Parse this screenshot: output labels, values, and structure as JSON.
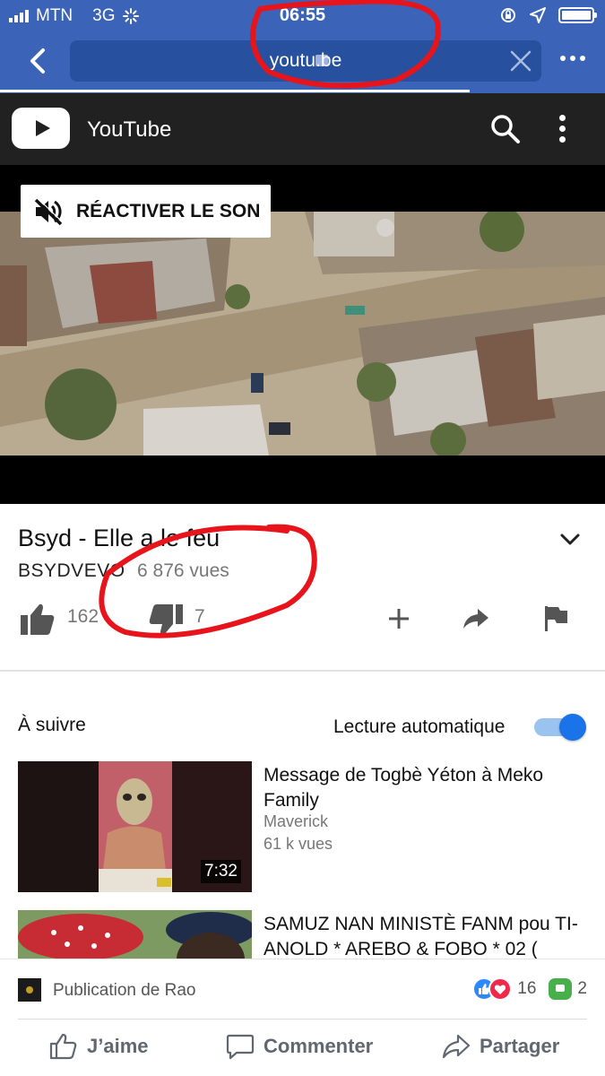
{
  "status_bar": {
    "carrier": "MTN",
    "network": "3G",
    "time": "06:55"
  },
  "browser": {
    "url": "youtu.be",
    "back_icon": "chevron-left-icon",
    "clear_icon": "close-icon",
    "more_icon": "more-horizontal-icon"
  },
  "youtube_header": {
    "app_name": "YouTube",
    "search_icon": "search-icon",
    "menu_icon": "more-vertical-icon"
  },
  "player": {
    "unmute_label": "RÉACTIVER LE SON",
    "unmute_icon": "volume-off-icon"
  },
  "video": {
    "title": "Bsyd - Elle a le feu",
    "channel": "BSYDVEVO",
    "views": "6 876 vues",
    "likes": "162",
    "dislikes": "7"
  },
  "up_next": {
    "label": "À suivre",
    "autoplay_label": "Lecture automatique",
    "autoplay_on": true,
    "items": [
      {
        "title": "Message de Togbè Yéton à Meko Family",
        "author": "Maverick",
        "views": "61 k vues",
        "duration": "7:32"
      },
      {
        "title": "SAMUZ NAN MINISTÈ FANM pou TI-ANOLD * AREBO & FOBO * 02 (",
        "author": "",
        "views": "",
        "duration": ""
      }
    ]
  },
  "facebook_footer": {
    "publication_label": "Publication de Rao",
    "reaction_count": "16",
    "comment_count": "2",
    "like_label": "J’aime",
    "comment_label": "Commenter",
    "share_label": "Partager"
  },
  "colors": {
    "facebook_blue": "#3b64b8",
    "youtube_dark": "#212121",
    "annotation_red": "#e8141b",
    "toggle_blue": "#1a73e8"
  }
}
